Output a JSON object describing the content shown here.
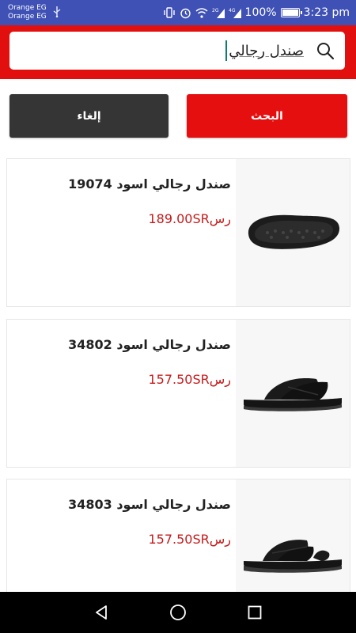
{
  "status_bar": {
    "carrier_1": "Orange EG",
    "carrier_2": "Orange EG",
    "battery_percent": "100%",
    "battery_level": 1.0,
    "time": "3:23 pm",
    "network_1": "2G",
    "network_2": "4G"
  },
  "search": {
    "value": "صندل رجالي"
  },
  "buttons": {
    "search_label": "البحث",
    "cancel_label": "إلغاء"
  },
  "products": [
    {
      "title": "صندل رجالي اسود 19074",
      "price": "189.00SRرس",
      "image": "black-sandal-sole"
    },
    {
      "title": "صندل رجالي اسود  34802",
      "price": "157.50SRرس",
      "image": "black-cross-strap-slide"
    },
    {
      "title": "صندل رجالي اسود 34803",
      "price": "157.50SRرس",
      "image": "black-toe-loop-sandal"
    }
  ],
  "colors": {
    "header_red": "#e20f0f",
    "status_blue": "#3f51b5",
    "price_red": "#c41a1a",
    "cancel_dark": "#353535"
  }
}
